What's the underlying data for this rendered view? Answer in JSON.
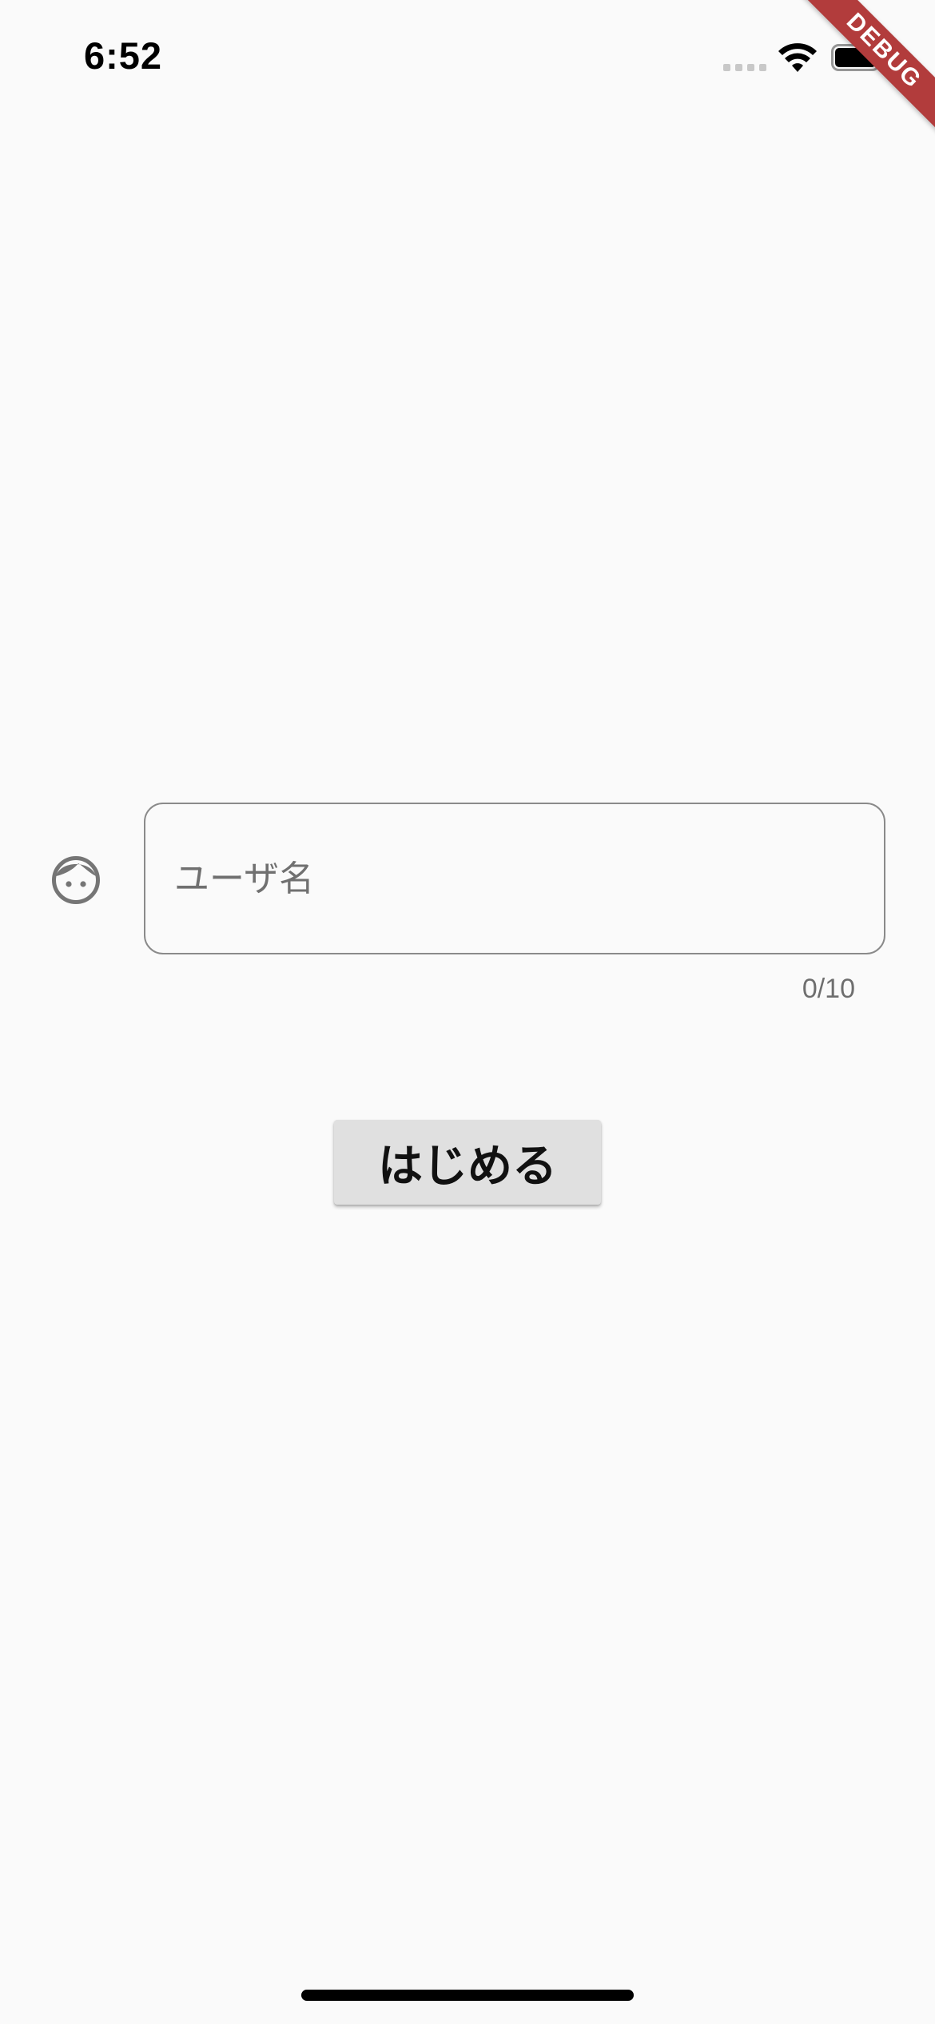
{
  "status_bar": {
    "time": "6:52",
    "signal_icon": "cellular-signal-icon",
    "wifi_icon": "wifi-icon",
    "battery_icon": "battery-icon"
  },
  "debug_banner": {
    "label": "DEBUG",
    "color": "#b23c3c"
  },
  "form": {
    "user_icon": "face-icon",
    "username_placeholder": "ユーザ名",
    "username_value": "",
    "counter": "0/10"
  },
  "actions": {
    "start_label": "はじめる"
  },
  "colors": {
    "background": "#fafafa",
    "button": "#e0e0e0",
    "outline": "#8a8a8a",
    "icon": "#757575"
  }
}
